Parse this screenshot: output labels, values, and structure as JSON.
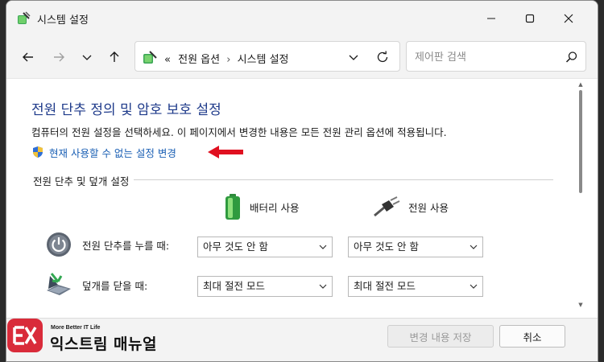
{
  "window": {
    "title": "시스템 설정"
  },
  "nav": {
    "breadcrumb_prefix": "«",
    "breadcrumb": [
      "전원 옵션",
      "시스템 설정"
    ],
    "breadcrumb_sep": "›",
    "search_placeholder": "제어판 검색"
  },
  "main": {
    "title": "전원 단추 정의 및 암호 보호 설정",
    "description": "컴퓨터의 전원 설정을 선택하세요. 이 페이지에서 변경한 내용은 모든 전원 관리 옵션에 적용됩니다.",
    "change_link": "현재 사용할 수 없는 설정 변경",
    "section_label": "전원 단추 및 덮개 설정",
    "columns": {
      "battery": "배터리 사용",
      "plugged": "전원 사용"
    },
    "rows": [
      {
        "label": "전원 단추를 누를 때:",
        "battery": "아무 것도 안 함",
        "plugged": "아무 것도 안 함"
      },
      {
        "label": "덮개를 닫을 때:",
        "battery": "최대 절전 모드",
        "plugged": "최대 절전 모드"
      }
    ]
  },
  "footer": {
    "save_label": "변경 내용 저장",
    "cancel_label": "취소"
  },
  "logo": {
    "tagline": "More Better IT Life",
    "name": "익스트림 매뉴얼"
  },
  "colors": {
    "title_blue": "#1e3a8a",
    "link_blue": "#1a5fb4",
    "arrow_red": "#e01020",
    "logo_red": "#d92b3a"
  }
}
